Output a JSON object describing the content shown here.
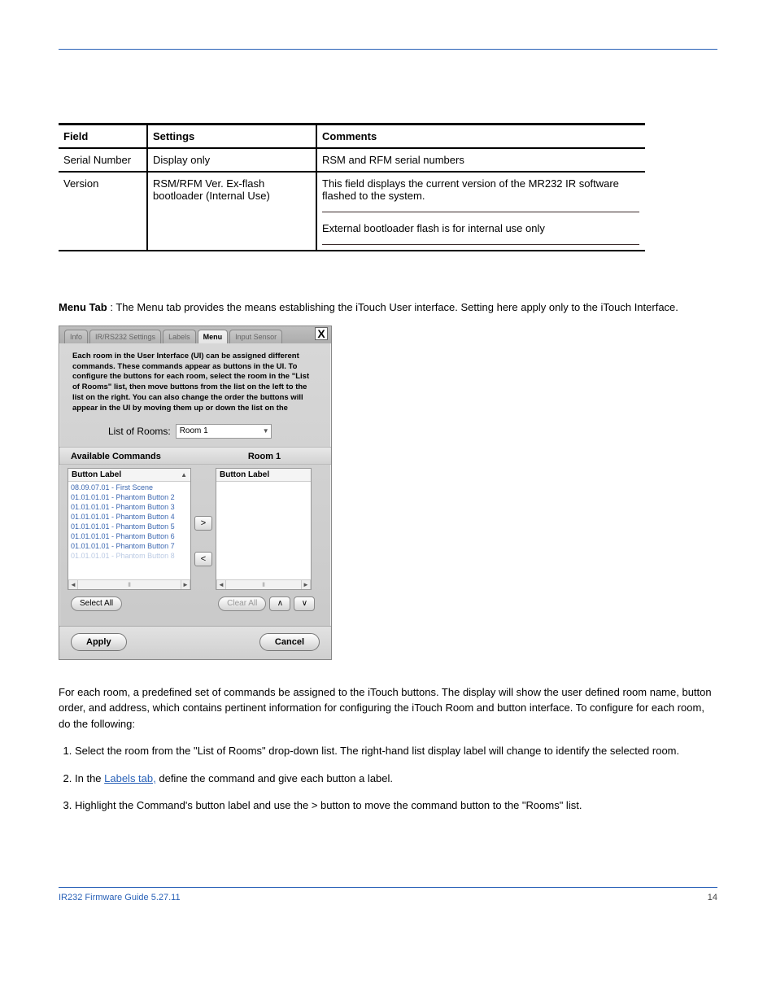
{
  "table": {
    "headers": {
      "field": "Field",
      "settings": "Settings",
      "comments": "Comments"
    },
    "row1": {
      "field": "Serial Number",
      "settings": "Display only",
      "comments": "RSM and RFM serial numbers"
    },
    "row2": {
      "field": "Version",
      "settings": "RSM/RFM Ver. Ex-flash bootloader (Internal Use)",
      "comments_a": "This field displays the current version of the MR232 IR software flashed to the system.",
      "comments_b": "External bootloader flash is for internal use only"
    }
  },
  "section": {
    "heading": "Menu Tab",
    "para": "The Menu tab provides the means establishing the iTouch User interface. Setting here apply only to the iTouch Interface."
  },
  "ui": {
    "tabs": [
      "Info",
      "IR/RS232 Settings",
      "Labels",
      "Menu",
      "Input Sensor"
    ],
    "close": "X",
    "desc": "Each room in the User Interface (UI) can be assigned different commands.   These commands appear as buttons in the UI.  To configure the buttons for each room, select the room in the \"List of Rooms\" list, then move buttons from the list on the left to the list on the right.  You can also change the order the buttons will appear in the UI by moving them up or down the list on the",
    "rooms_label": "List of Rooms:",
    "rooms_value": "Room 1",
    "available_header": "Available Commands",
    "room_header": "Room 1",
    "button_label_header": "Button Label",
    "list_items": [
      "08.09.07.01 - First Scene",
      "01.01.01.01 - Phantom Button 2",
      "01.01.01.01 - Phantom Button 3",
      "01.01.01.01 - Phantom Button 4",
      "01.01.01.01 - Phantom Button 5",
      "01.01.01.01 - Phantom Button 6",
      "01.01.01.01 - Phantom Button 7",
      "01.01.01.01 - Phantom Button 8"
    ],
    "move_right": ">",
    "move_left": "<",
    "select_all": "Select All",
    "clear_all": "Clear All",
    "up": "∧",
    "down": "∨",
    "apply": "Apply",
    "cancel": "Cancel"
  },
  "instructions": {
    "lead": "For each room, a predefined set of commands be assigned to the iTouch buttons. The display will show the user defined room name, button order, and address, which contains pertinent information for configuring the iTouch Room and button interface. To configure for each room, do the following:",
    "step1": "Select the room from the \"List of Rooms\" drop-down list. The right-hand list display label will change to identify the selected room.",
    "step2_a": "In the ",
    "step2_link": "Labels tab,",
    "step2_b": " define the command and give each button a label.",
    "step3": "Highlight the Command's button label and use the > button to move the command button to the \"Rooms\" list."
  },
  "footer": {
    "left": "IR232  Firmware Guide 5.27.11",
    "right": "14"
  }
}
